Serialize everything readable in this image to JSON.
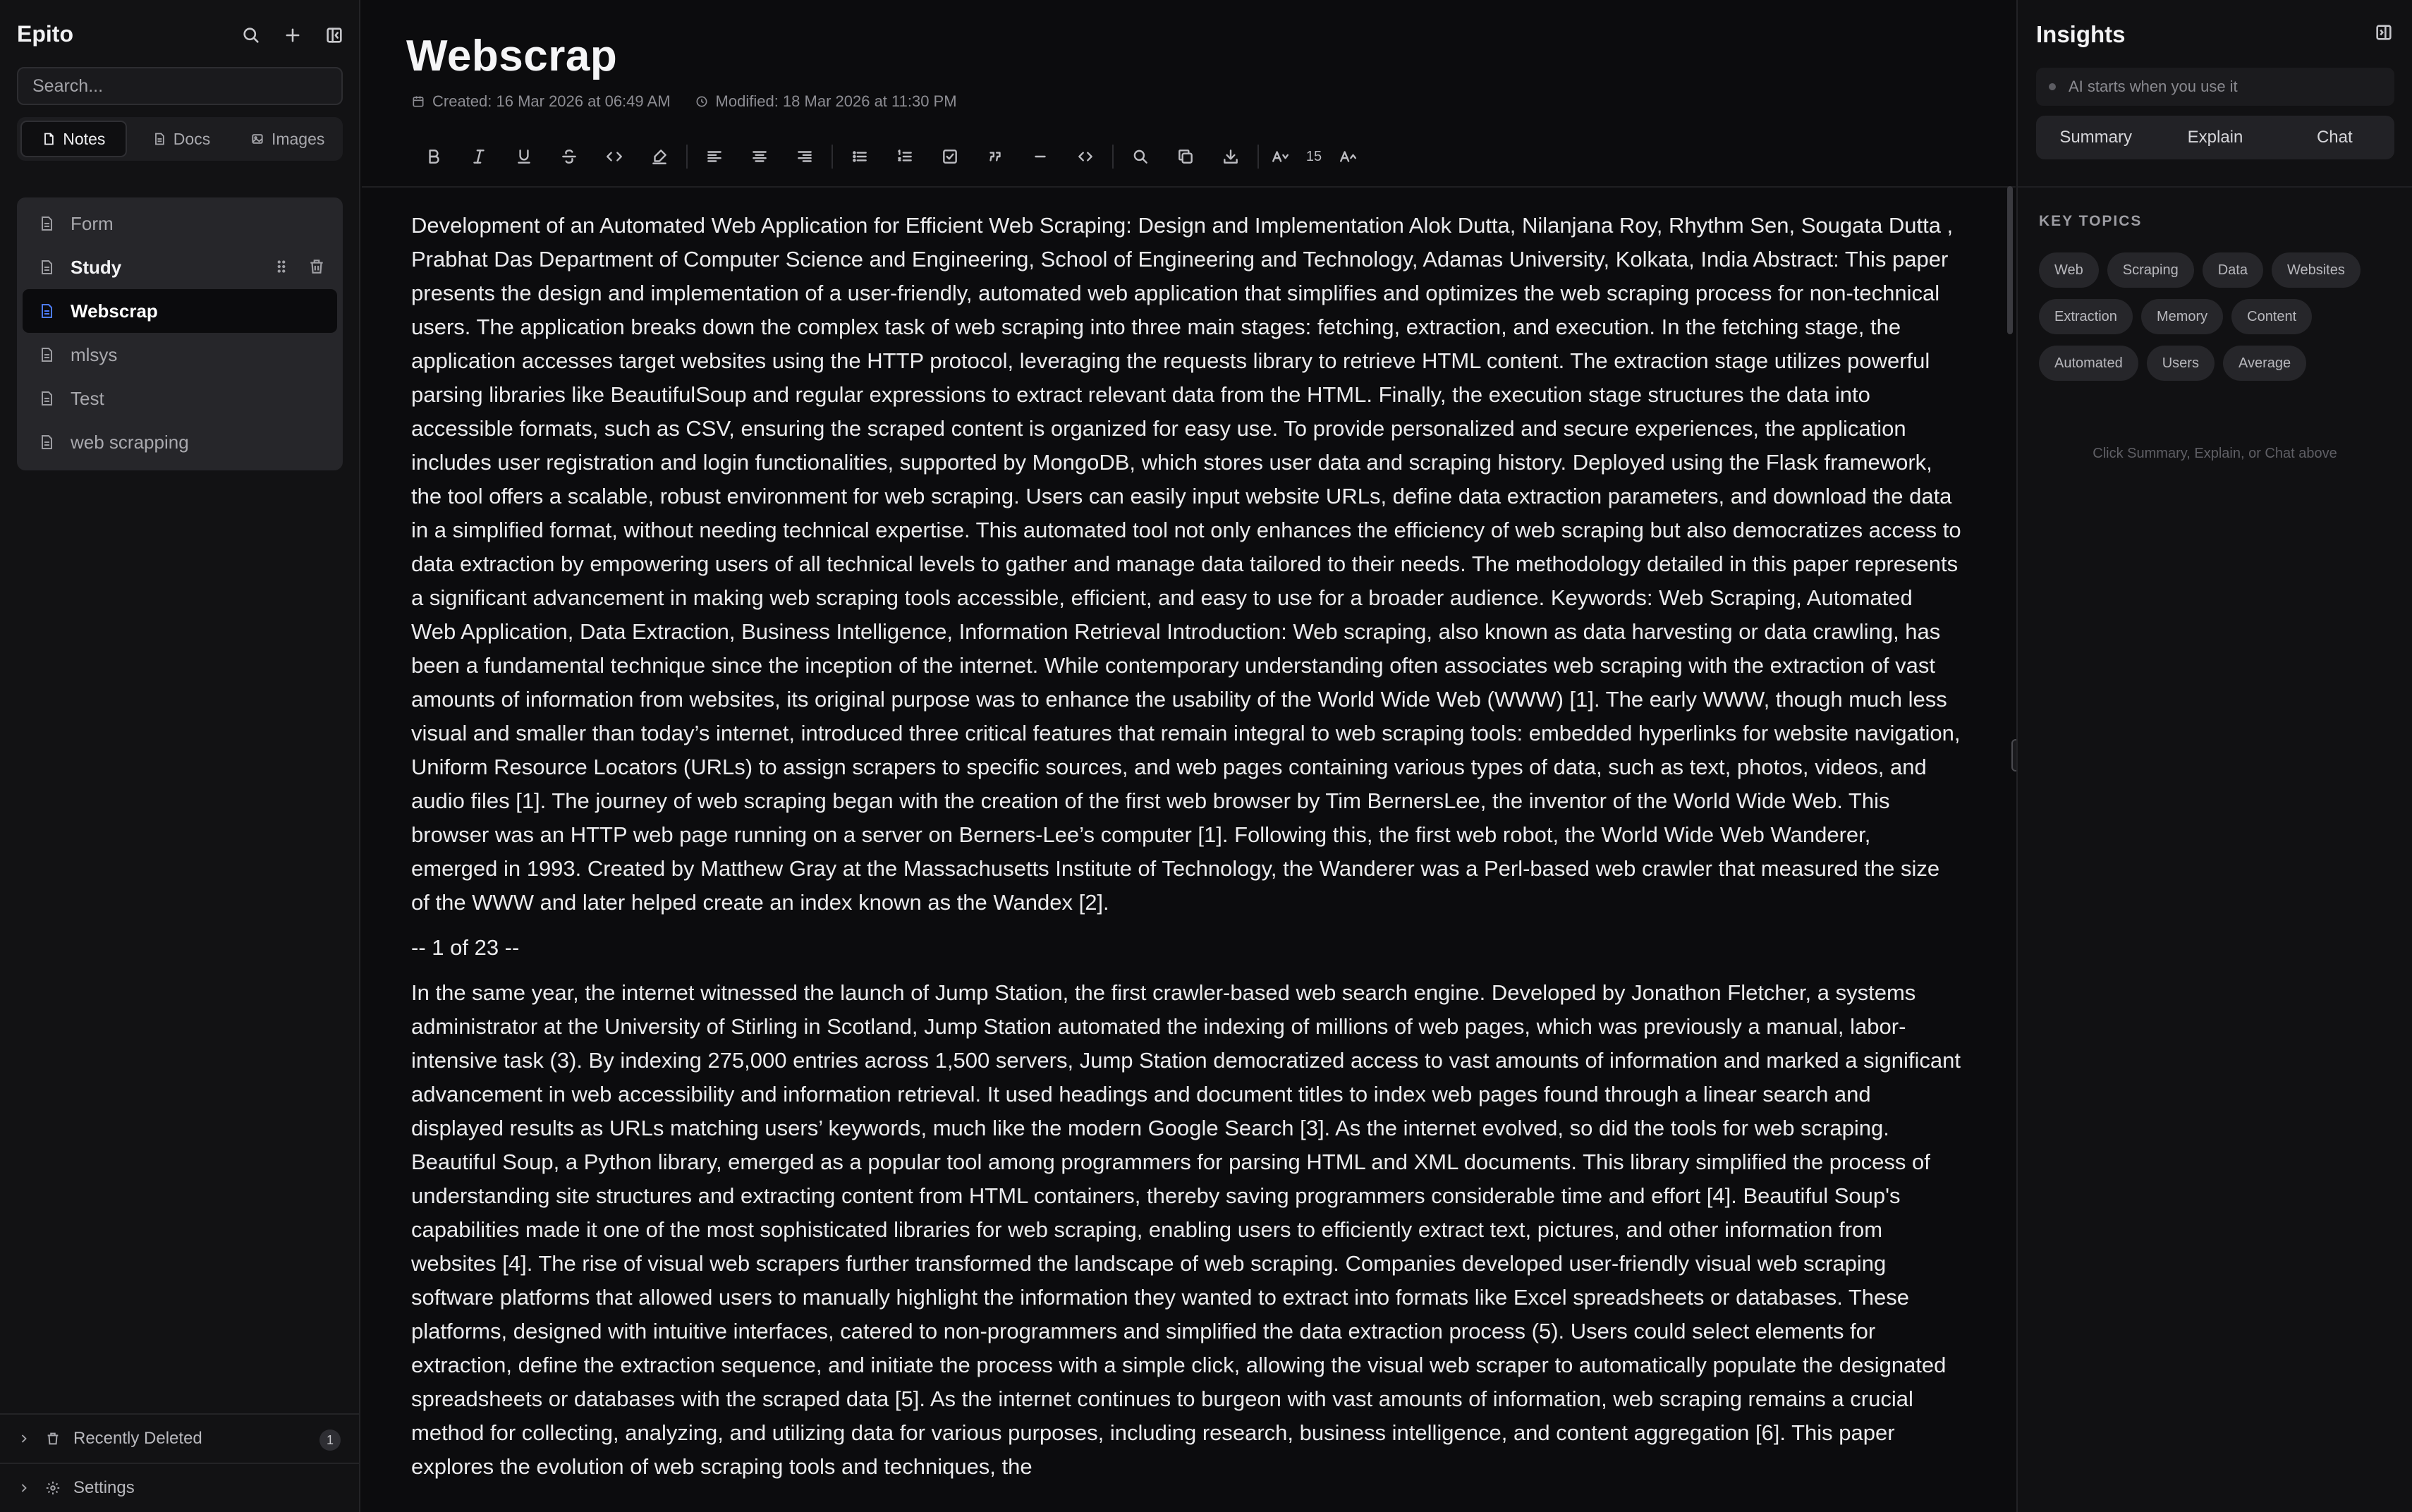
{
  "sidebar": {
    "app_name": "Epito",
    "search_placeholder": "Search...",
    "tabs": [
      {
        "label": "Notes",
        "icon": "note-icon"
      },
      {
        "label": "Docs",
        "icon": "doc-icon"
      },
      {
        "label": "Images",
        "icon": "image-icon"
      }
    ],
    "notes": [
      {
        "title": "Form"
      },
      {
        "title": "Study"
      },
      {
        "title": "Webscrap"
      },
      {
        "title": "mlsys"
      },
      {
        "title": "Test"
      },
      {
        "title": "web scrapping"
      }
    ],
    "recently_deleted": {
      "label": "Recently Deleted",
      "count": "1"
    },
    "settings_label": "Settings"
  },
  "editor": {
    "title": "Webscrap",
    "created": "Created: 16 Mar 2026 at 06:49 AM",
    "modified": "Modified: 18 Mar 2026 at 11:30 PM",
    "font_size": "15",
    "paragraphs": [
      "Development of an Automated Web Application for Efficient Web Scraping: Design and Implementation Alok Dutta, Nilanjana Roy, Rhythm Sen, Sougata Dutta , Prabhat Das Department of Computer Science and Engineering, School of Engineering and Technology, Adamas University, Kolkata, India Abstract: This paper presents the design and implementation of a user-friendly, automated web application that simplifies and optimizes the web scraping process for non-technical users. The application breaks down the complex task of web scraping into three main stages: fetching, extraction, and execution. In the fetching stage, the application accesses target websites using the HTTP protocol, leveraging the requests library to retrieve HTML content. The extraction stage utilizes powerful parsing libraries like BeautifulSoup and regular expressions to extract relevant data from the HTML. Finally, the execution stage structures the data into accessible formats, such as CSV, ensuring the scraped content is organized for easy use. To provide personalized and secure experiences, the application includes user registration and login functionalities, supported by MongoDB, which stores user data and scraping history. Deployed using the Flask framework, the tool offers a scalable, robust environment for web scraping. Users can easily input website URLs, define data extraction parameters, and download the data in a simplified format, without needing technical expertise. This automated tool not only enhances the efficiency of web scraping but also democratizes access to data extraction by empowering users of all technical levels to gather and manage data tailored to their needs. The methodology detailed in this paper represents a significant advancement in making web scraping tools accessible, efficient, and easy to use for a broader audience. Keywords: Web Scraping, Automated Web Application, Data Extraction, Business Intelligence, Information Retrieval Introduction: Web scraping, also known as data harvesting or data crawling, has been a fundamental technique since the inception of the internet. While contemporary understanding often associates web scraping with the extraction of vast amounts of information from websites, its original purpose was to enhance the usability of the World Wide Web (WWW) [1]. The early WWW, though much less visual and smaller than today’s internet, introduced three critical features that remain integral to web scraping tools: embedded hyperlinks for website navigation, Uniform Resource Locators (URLs) to assign scrapers to specific sources, and web pages containing various types of data, such as text, photos, videos, and audio files [1]. The journey of web scraping began with the creation of the first web browser by Tim BernersLee, the inventor of the World Wide Web. This browser was an HTTP web page running on a server on Berners-Lee’s computer [1]. Following this, the first web robot, the World Wide Web Wanderer, emerged in 1993. Created by Matthew Gray at the Massachusetts Institute of Technology, the Wanderer was a Perl-based web crawler that measured the size of the WWW and later helped create an index known as the Wandex [2].",
      "-- 1 of 23 --",
      "In the same year, the internet witnessed the launch of Jump Station, the first crawler-based web search engine. Developed by Jonathon Fletcher, a systems administrator at the University of Stirling in Scotland, Jump Station automated the indexing of millions of web pages, which was previously a manual, labor-intensive task (3). By indexing 275,000 entries across 1,500 servers, Jump Station democratized access to vast amounts of information and marked a significant advancement in web accessibility and information retrieval. It used headings and document titles to index web pages found through a linear search and displayed results as URLs matching users’ keywords, much like the modern Google Search [3]. As the internet evolved, so did the tools for web scraping. Beautiful Soup, a Python library, emerged as a popular tool among programmers for parsing HTML and XML documents. This library simplified the process of understanding site structures and extracting content from HTML containers, thereby saving programmers considerable time and effort [4]. Beautiful Soup's capabilities made it one of the most sophisticated libraries for web scraping, enabling users to efficiently extract text, pictures, and other information from websites [4]. The rise of visual web scrapers further transformed the landscape of web scraping. Companies developed user-friendly visual web scraping software platforms that allowed users to manually highlight the information they wanted to extract into formats like Excel spreadsheets or databases. These platforms, designed with intuitive interfaces, catered to non-programmers and simplified the data extraction process (5). Users could select elements for extraction, define the extraction sequence, and initiate the process with a simple click, allowing the visual web scraper to automatically populate the designated spreadsheets or databases with the scraped data [5]. As the internet continues to burgeon with vast amounts of information, web scraping remains a crucial method for collecting, analyzing, and utilizing data for various purposes, including research, business intelligence, and content aggregation [6]. This paper explores the evolution of web scraping tools and techniques, the"
    ]
  },
  "insights": {
    "title": "Insights",
    "ai_placeholder": "AI starts when you use it",
    "tabs": [
      "Summary",
      "Explain",
      "Chat"
    ],
    "key_topics_label": "KEY TOPICS",
    "topics": [
      "Web",
      "Scraping",
      "Data",
      "Websites",
      "Extraction",
      "Memory",
      "Content",
      "Automated",
      "Users",
      "Average"
    ],
    "hint": "Click Summary, Explain, or Chat above"
  },
  "colors": {
    "background": "#0c0c0e",
    "sidebar": "#121214",
    "accent_doc_icon": "#4d7cff"
  }
}
